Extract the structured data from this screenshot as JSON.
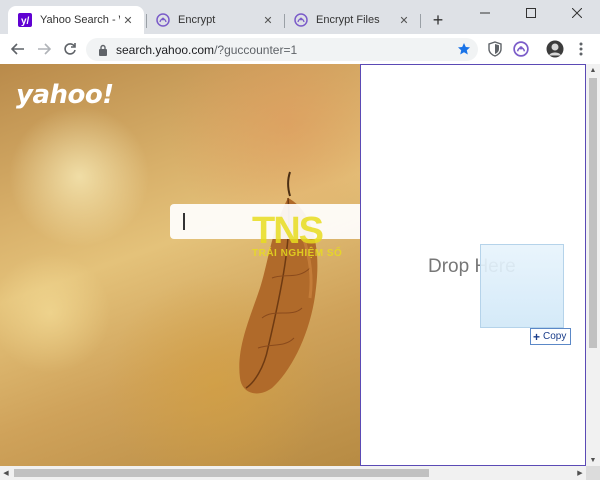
{
  "tabs": [
    {
      "title": "Yahoo Search - Web Search",
      "favicon": "yahoo-favicon-icon",
      "active": true
    },
    {
      "title": "Encrypt",
      "favicon": "extension-favicon-icon",
      "active": false
    },
    {
      "title": "Encrypt Files",
      "favicon": "extension-favicon-icon",
      "active": false
    }
  ],
  "toolbar": {
    "url_host": "search.yahoo.com",
    "url_path": "/?guccounter=1"
  },
  "page": {
    "logo": "yahoo!",
    "search_placeholder": "",
    "drop_text": "Drop Here",
    "copy_label": "Copy",
    "watermark_big": "TNS",
    "watermark_small": "TRẢI NGHIỆM SỐ"
  },
  "colors": {
    "accent_purple": "#5b4ab5",
    "star_blue": "#1a73e8",
    "yahoo_purple": "#6001d2"
  }
}
